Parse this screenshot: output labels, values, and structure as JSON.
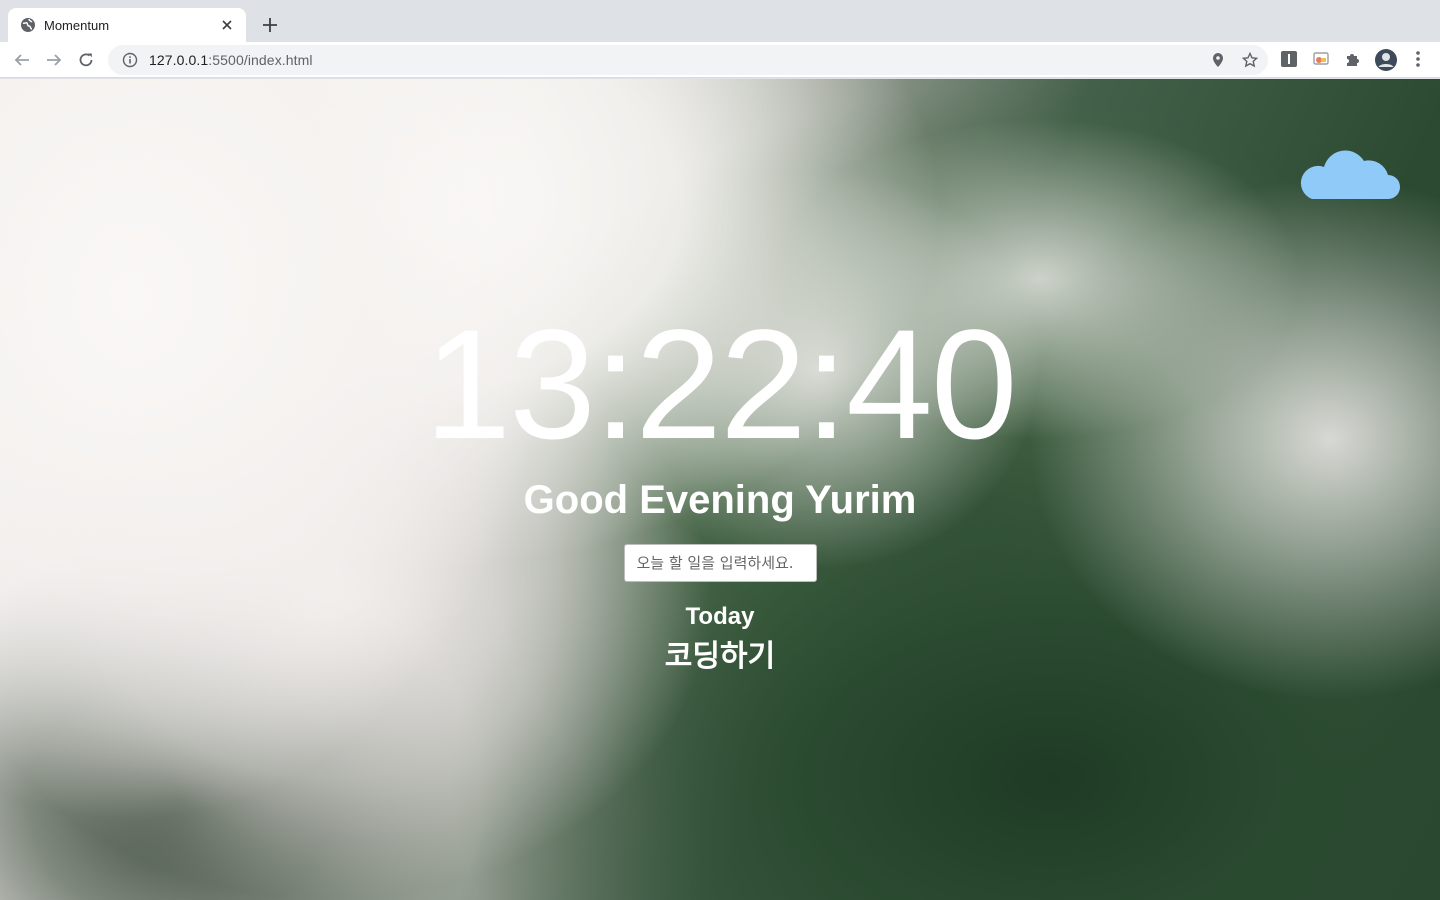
{
  "browser": {
    "tab_title": "Momentum",
    "url_host": "127.0.0.1",
    "url_rest": ":5500/index.html"
  },
  "page": {
    "clock": "13:22:40",
    "greeting": "Good Evening Yurim",
    "todo_placeholder": "오늘 할 일을 입력하세요.",
    "today_label": "Today",
    "todos": [
      "코딩하기"
    ],
    "weather_icon": "cloud-icon",
    "weather_color": "#90caf9"
  }
}
